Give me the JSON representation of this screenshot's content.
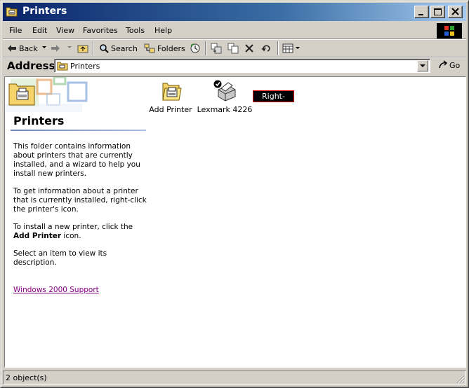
{
  "window": {
    "title": "Printers"
  },
  "menu": {
    "items": [
      "File",
      "Edit",
      "View",
      "Favorites",
      "Tools",
      "Help"
    ]
  },
  "toolbar": {
    "back_label": "Back",
    "search_label": "Search",
    "folders_label": "Folders"
  },
  "address": {
    "label": "Address",
    "value": "Printers",
    "go_label": "Go"
  },
  "left_pane": {
    "title": "Printers",
    "paragraphs": [
      "This folder contains information about printers that are currently installed, and a wizard to help you install new printers.",
      "To get information about a printer that is currently installed, right-click the printer's icon."
    ],
    "install_prefix": "To install a new printer, click the ",
    "install_bold": "Add Printer",
    "install_suffix": " icon.",
    "select_text": "Select an item to view its description.",
    "support_link": "Windows 2000 Support"
  },
  "items": [
    {
      "label": "Add Printer"
    },
    {
      "label": "Lexmark 4226"
    }
  ],
  "annotation": {
    "label": "Right-Click"
  },
  "status": {
    "text": "2 object(s)"
  },
  "colors": {
    "titlebar_start": "#0a246a",
    "titlebar_end": "#a6caf0",
    "link": "#800080",
    "highlight_border": "#e00000"
  },
  "icons": [
    "folder-printer-icon",
    "minimize-icon",
    "maximize-icon",
    "close-icon",
    "windows-logo-icon",
    "back-arrow-icon",
    "forward-arrow-icon",
    "up-folder-icon",
    "search-icon",
    "folders-icon",
    "history-icon",
    "move-to-icon",
    "copy-to-icon",
    "delete-icon",
    "undo-icon",
    "views-icon",
    "go-icon",
    "add-printer-icon",
    "printer-icon",
    "size-grip-icon"
  ]
}
